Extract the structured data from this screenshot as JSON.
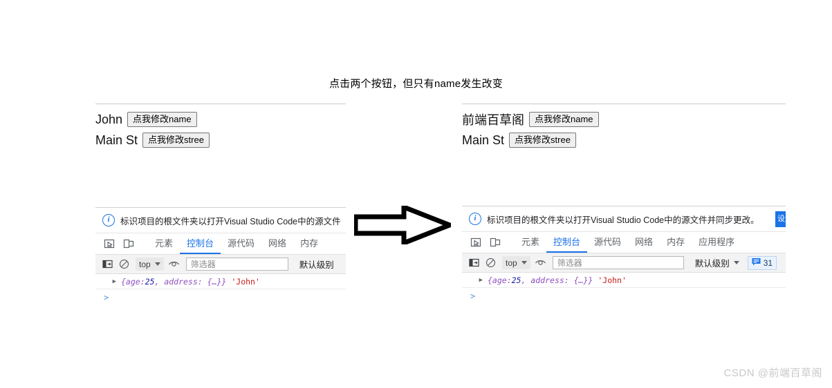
{
  "page": {
    "title": "点击两个按钮，但只有name发生改变",
    "watermark": "CSDN @前端百草阁"
  },
  "demo_before": {
    "name_value": "John",
    "name_button": "点我修改name",
    "street_value": "Main St",
    "street_button": "点我修改stree"
  },
  "demo_after": {
    "name_value": "前端百草阁",
    "name_button": "点我修改name",
    "street_value": "Main St",
    "street_button": "点我修改stree"
  },
  "devtools_left": {
    "info_icon": "info-circle-icon",
    "info_text": "标识项目的根文件夹以打开Visual Studio Code中的源文件",
    "inspect_icon": "inspect-element-icon",
    "device_icon": "device-toolbar-icon",
    "tabs": [
      {
        "label": "元素",
        "active": false
      },
      {
        "label": "控制台",
        "active": true
      },
      {
        "label": "源代码",
        "active": false
      },
      {
        "label": "网络",
        "active": false
      },
      {
        "label": "内存",
        "active": false
      }
    ],
    "toolbar": {
      "sidebar_icon": "console-sidebar-icon",
      "clear_icon": "clear-console-icon",
      "context": "top",
      "eye_icon": "live-expression-icon",
      "filter_placeholder": "筛选器",
      "level_label": "默认级别"
    },
    "console_rows": [
      {
        "disclosure": "▶",
        "object": "{age: 25, address: {…}}",
        "object_head": "{age: ",
        "object_num": "25",
        "object_tail": ", address: {…}}",
        "string": "'John'"
      }
    ],
    "prompt": ">"
  },
  "devtools_right": {
    "info_icon": "info-circle-icon",
    "info_text": "标识项目的根文件夹以打开Visual Studio Code中的源文件并同步更改。",
    "info_action_label": "设置",
    "inspect_icon": "inspect-element-icon",
    "device_icon": "device-toolbar-icon",
    "tabs": [
      {
        "label": "元素",
        "active": false
      },
      {
        "label": "控制台",
        "active": true
      },
      {
        "label": "源代码",
        "active": false
      },
      {
        "label": "网络",
        "active": false
      },
      {
        "label": "内存",
        "active": false
      },
      {
        "label": "应用程序",
        "active": false
      }
    ],
    "toolbar": {
      "sidebar_icon": "console-sidebar-icon",
      "clear_icon": "clear-console-icon",
      "context": "top",
      "eye_icon": "live-expression-icon",
      "filter_placeholder": "筛选器",
      "level_label": "默认级别",
      "badge_icon": "message-badge-icon",
      "badge_count": "31"
    },
    "console_rows": [
      {
        "disclosure": "▶",
        "object_head": "{age: ",
        "object_num": "25",
        "object_tail": ", address: {…}}",
        "string": "'John'"
      }
    ],
    "prompt": ">"
  },
  "arrow": {
    "name": "right-arrow",
    "color": "#000000"
  },
  "colors": {
    "accent_blue": "#1a73e8",
    "string_red": "#c41a16",
    "object_purple": "#8f4fbf",
    "number_blue": "#1a1aa6"
  }
}
